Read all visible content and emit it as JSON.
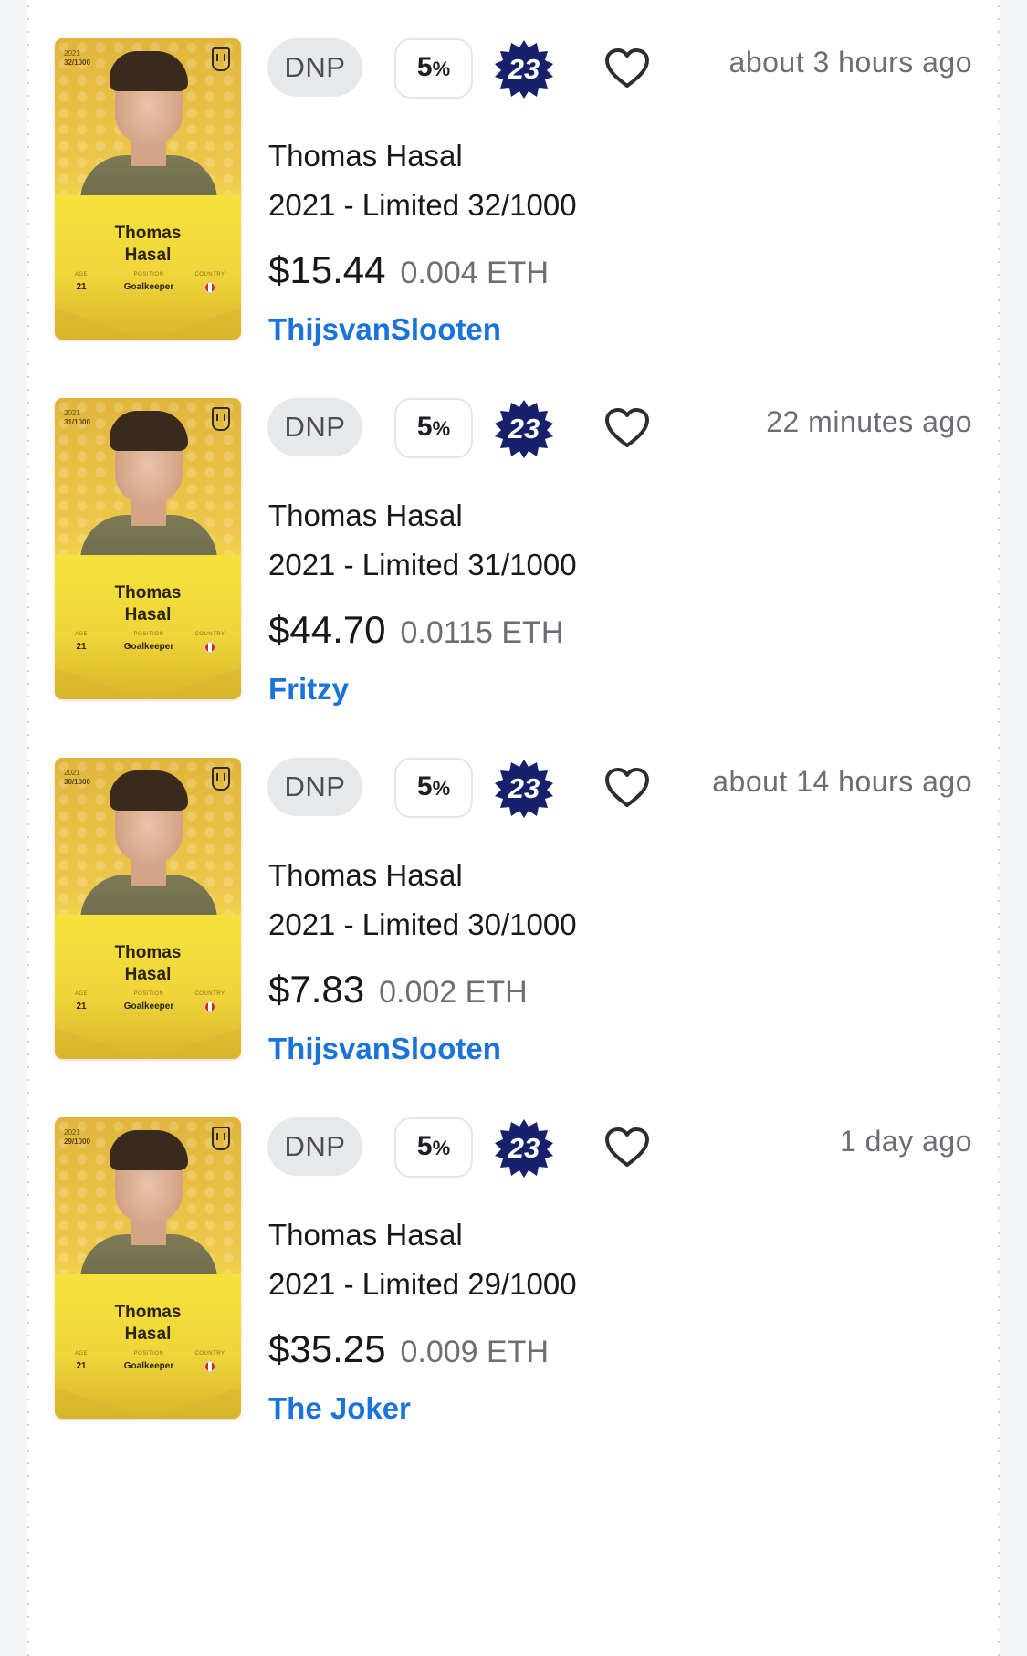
{
  "colors": {
    "accent_link": "#1a73d9",
    "badge_navy": "#17206b",
    "card_gold": "#eec84a"
  },
  "listings": [
    {
      "card": {
        "year": "2021",
        "serial": "32/1000",
        "name_first": "Thomas",
        "name_last": "Hasal",
        "age_label": "AGE",
        "age": "21",
        "position_label": "POSITION",
        "position": "Goalkeeper",
        "country_label": "COUNTRY",
        "country_icon": "canada-flag-icon"
      },
      "status": "DNP",
      "bonus_value": "5",
      "bonus_symbol": "%",
      "score": "23",
      "favorite_icon": "heart-outline-icon",
      "time": "about 3 hours ago",
      "player": "Thomas Hasal",
      "edition": "2021 - Limited 32/1000",
      "price_usd": "$15.44",
      "price_eth": "0.004 ETH",
      "seller": "ThijsvanSlooten"
    },
    {
      "card": {
        "year": "2021",
        "serial": "31/1000",
        "name_first": "Thomas",
        "name_last": "Hasal",
        "age_label": "AGE",
        "age": "21",
        "position_label": "POSITION",
        "position": "Goalkeeper",
        "country_label": "COUNTRY",
        "country_icon": "canada-flag-icon"
      },
      "status": "DNP",
      "bonus_value": "5",
      "bonus_symbol": "%",
      "score": "23",
      "favorite_icon": "heart-outline-icon",
      "time": "22 minutes ago",
      "player": "Thomas Hasal",
      "edition": "2021 - Limited 31/1000",
      "price_usd": "$44.70",
      "price_eth": "0.0115 ETH",
      "seller": "Fritzy"
    },
    {
      "card": {
        "year": "2021",
        "serial": "30/1000",
        "name_first": "Thomas",
        "name_last": "Hasal",
        "age_label": "AGE",
        "age": "21",
        "position_label": "POSITION",
        "position": "Goalkeeper",
        "country_label": "COUNTRY",
        "country_icon": "canada-flag-icon"
      },
      "status": "DNP",
      "bonus_value": "5",
      "bonus_symbol": "%",
      "score": "23",
      "favorite_icon": "heart-outline-icon",
      "time": "about 14 hours ago",
      "player": "Thomas Hasal",
      "edition": "2021 - Limited 30/1000",
      "price_usd": "$7.83",
      "price_eth": "0.002 ETH",
      "seller": "ThijsvanSlooten"
    },
    {
      "card": {
        "year": "2021",
        "serial": "29/1000",
        "name_first": "Thomas",
        "name_last": "Hasal",
        "age_label": "AGE",
        "age": "21",
        "position_label": "POSITION",
        "position": "Goalkeeper",
        "country_label": "COUNTRY",
        "country_icon": "canada-flag-icon"
      },
      "status": "DNP",
      "bonus_value": "5",
      "bonus_symbol": "%",
      "score": "23",
      "favorite_icon": "heart-outline-icon",
      "time": "1 day ago",
      "player": "Thomas Hasal",
      "edition": "2021 - Limited 29/1000",
      "price_usd": "$35.25",
      "price_eth": "0.009 ETH",
      "seller": "The Joker"
    }
  ]
}
